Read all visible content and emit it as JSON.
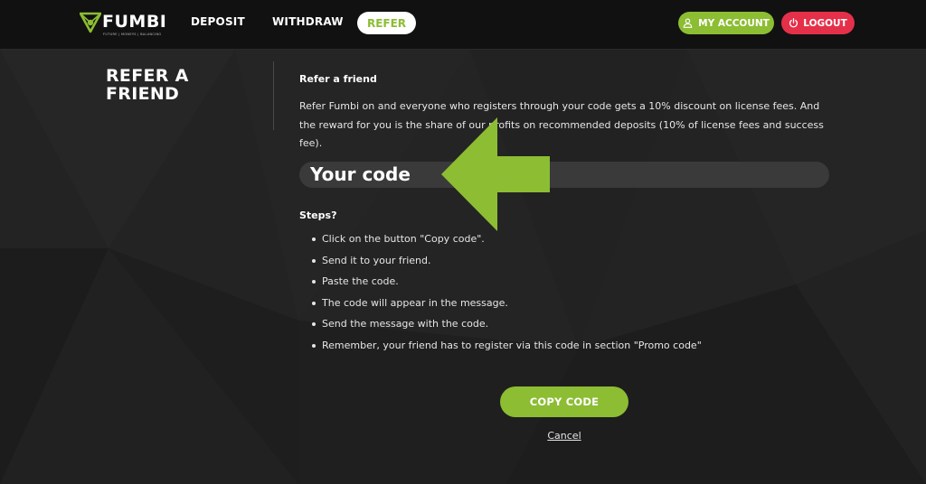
{
  "brand": {
    "name": "FUMBI",
    "tagline": "FUTURE | MONEYS | BALANCING",
    "accent_color": "#8cbd33",
    "danger_color": "#e5304a"
  },
  "nav": {
    "deposit": "DEPOSIT",
    "withdraw": "WITHDRAW",
    "refer": "REFER",
    "my_account": "MY ACCOUNT",
    "my_account_icon": "user-icon",
    "logout": "LOGOUT",
    "logout_icon": "power-icon"
  },
  "page": {
    "title": "REFER A FRIEND",
    "section_title": "Refer a friend",
    "description": "Refer Fumbi on and everyone who registers through your code gets a 10% discount on license fees. And the reward for you is the share of our profits on recommended deposits (10% of license fees and success fee).",
    "code_label": "Your code",
    "annotation_icon": "arrow-left-icon",
    "steps_title": "Steps?",
    "steps": [
      "Click on the button \"Copy code\".",
      "Send it to your friend.",
      "Paste the code.",
      "The code will appear in the message.",
      "Send the message with the code.",
      "Remember, your friend has to register via this code in section \"Promo code\""
    ],
    "copy_button": "COPY CODE",
    "cancel": "Cancel"
  }
}
